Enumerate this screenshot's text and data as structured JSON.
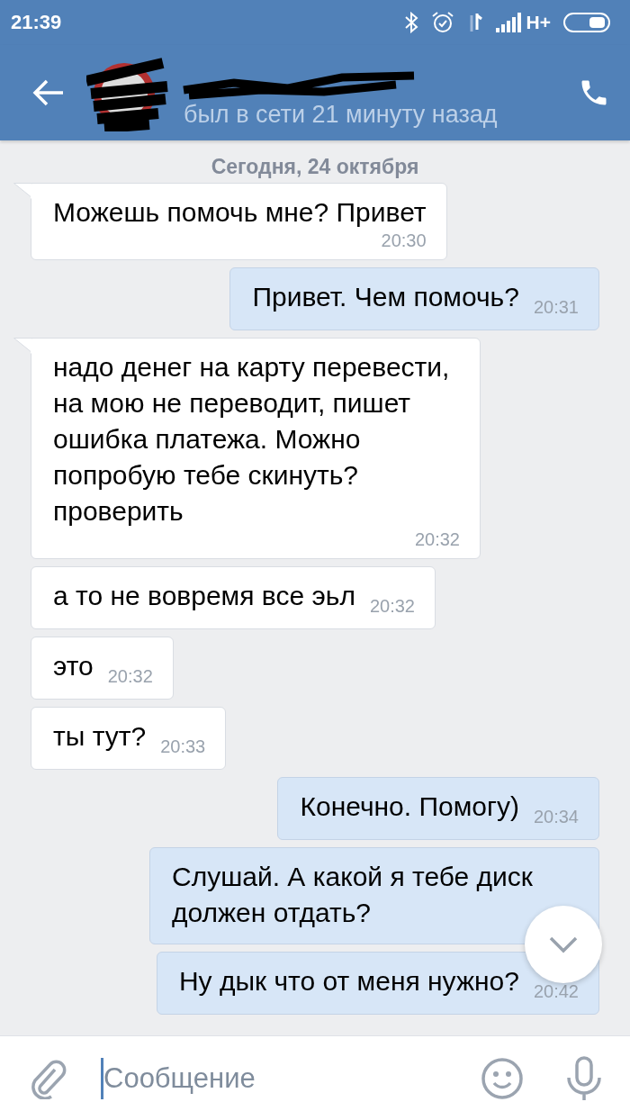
{
  "status_bar": {
    "time": "21:39",
    "network": "H+"
  },
  "header": {
    "last_seen": "был в сети 21 минуту назад"
  },
  "date_divider": "Сегодня, 24 октября",
  "messages": [
    {
      "kind": "incoming",
      "tail": true,
      "text": "Можешь помочь мне? Привет",
      "time": "20:30"
    },
    {
      "kind": "outgoing",
      "tail": false,
      "text": "Привет. Чем помочь?",
      "time": "20:31"
    },
    {
      "kind": "incoming",
      "tail": true,
      "text": "надо денег на карту перевести, на мою не переводит, пишет ошибка платежа. Можно попробую тебе скинуть? проверить",
      "time": "20:32"
    },
    {
      "kind": "incoming",
      "tail": false,
      "text": "а то не вовремя все эьл",
      "time": "20:32"
    },
    {
      "kind": "incoming",
      "tail": false,
      "text": "это",
      "time": "20:32"
    },
    {
      "kind": "incoming",
      "tail": false,
      "text": "ты тут?",
      "time": "20:33"
    },
    {
      "kind": "outgoing",
      "tail": false,
      "text": "Конечно. Помогу)",
      "time": "20:34"
    },
    {
      "kind": "outgoing",
      "tail": false,
      "text": "Слушай. А какой я тебе диск должен отдать?"
    },
    {
      "kind": "outgoing",
      "tail": false,
      "text": "Ну дык что от меня нужно?",
      "time": "20:42"
    }
  ],
  "composer": {
    "placeholder": "Сообщение"
  }
}
